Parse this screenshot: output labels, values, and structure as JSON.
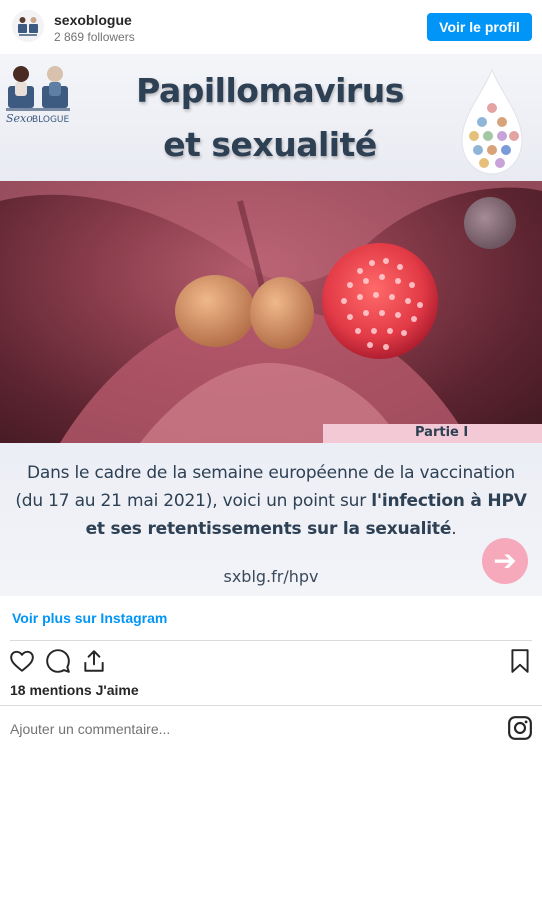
{
  "header": {
    "username": "sexoblogue",
    "followers": "2 869 followers",
    "profile_button": "Voir le profil"
  },
  "post": {
    "title_line1": "Papillomavirus",
    "title_line2": "et sexualité",
    "logo_text": "SexoBLOGUE",
    "partie": "Partie I",
    "desc_line1": "Dans le cadre de la semaine européenne de la vaccination",
    "desc_line2_normal": "(du 17 au 21 mai 2021), voici un point sur ",
    "desc_line2_bold": "l'infection à HPV",
    "desc_line3_bold": "et ses retentissements sur la sexualité",
    "desc_line3_end": ".",
    "link": "sxblg.fr/hpv",
    "next_arrow": "➔"
  },
  "footer": {
    "more_link": "Voir plus sur Instagram",
    "likes": "18 mentions J'aime",
    "comment_placeholder": "Ajouter un commentaire..."
  },
  "icons": {
    "like": "heart-icon",
    "comment": "comment-icon",
    "share": "share-icon",
    "save": "bookmark-icon",
    "instagram": "instagram-icon"
  },
  "colors": {
    "accent": "#0095f6",
    "title": "#2e4054",
    "banner": "#f2c9d4",
    "arrow_circle": "#f5a9ba"
  }
}
